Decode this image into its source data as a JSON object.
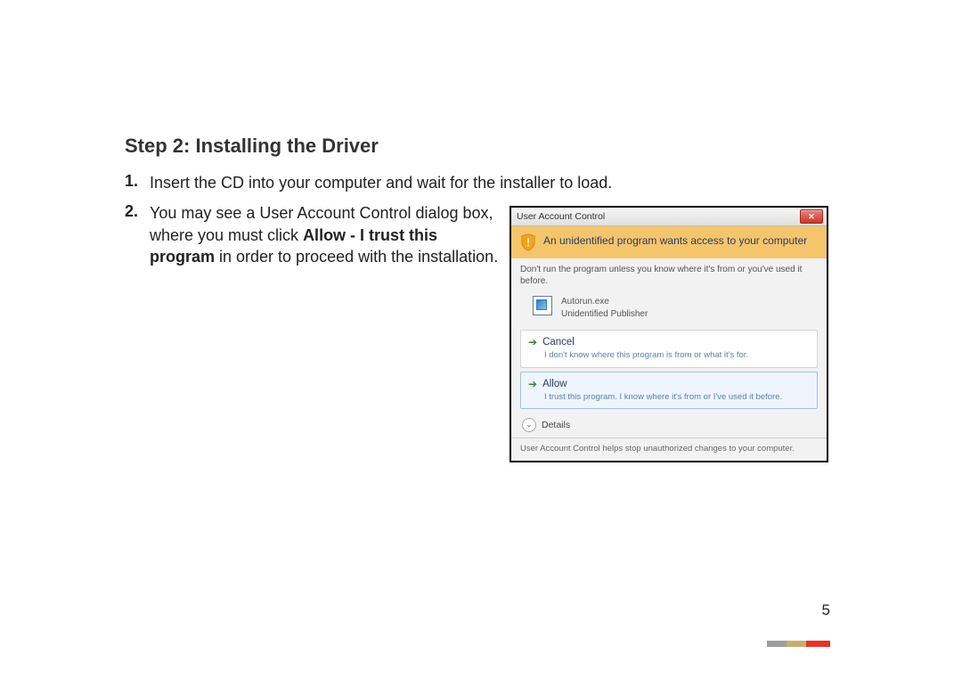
{
  "heading": "Step 2: Installing the Driver",
  "items": {
    "n1": "1.",
    "t1": "Insert the CD into your computer and wait for the installer to load.",
    "n2": "2.",
    "t2a": "You may see a User Account Control dialog box, where you must click ",
    "t2b": "Allow - I trust this program",
    "t2c": " in order to proceed with the installation."
  },
  "uac": {
    "title": "User Account Control",
    "banner": "An unidentified program wants access to your computer",
    "warn": "Don't run the program unless you know where it's from or you've used it before.",
    "program": "Autorun.exe",
    "publisher": "Unidentified Publisher",
    "cancel": "Cancel",
    "cancel_sub": "I don't know where this program is from or what it's for.",
    "allow": "Allow",
    "allow_sub": "I trust this program. I know where it's from or I've used it before.",
    "details": "Details",
    "footer": "User Account Control helps stop unauthorized changes to your computer."
  },
  "page_number": "5"
}
